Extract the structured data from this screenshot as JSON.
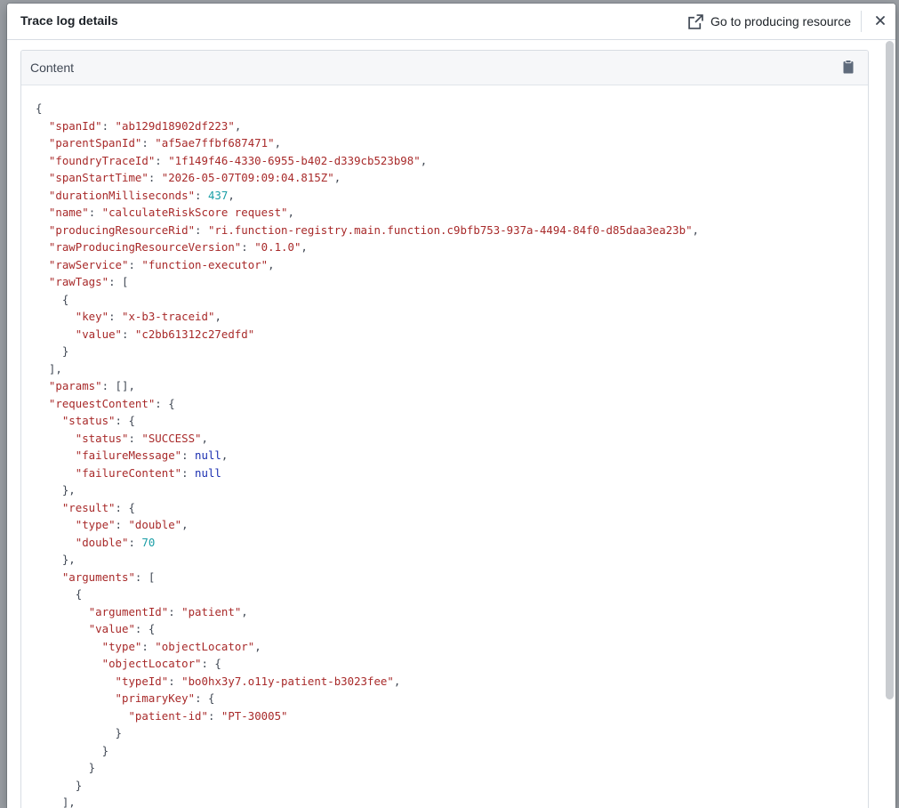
{
  "dialog": {
    "title": "Trace log details",
    "goto_label": "Go to producing resource",
    "content_label": "Content"
  },
  "icons": {
    "goto": "external-link-icon",
    "close": "close-icon",
    "copy": "clipboard-icon"
  },
  "json_lines": [
    [
      [
        "p",
        "{"
      ]
    ],
    [
      [
        "p",
        "  "
      ],
      [
        "k",
        "\"spanId\""
      ],
      [
        "p",
        ": "
      ],
      [
        "s",
        "\"ab129d18902df223\""
      ],
      [
        "p",
        ","
      ]
    ],
    [
      [
        "p",
        "  "
      ],
      [
        "k",
        "\"parentSpanId\""
      ],
      [
        "p",
        ": "
      ],
      [
        "s",
        "\"af5ae7ffbf687471\""
      ],
      [
        "p",
        ","
      ]
    ],
    [
      [
        "p",
        "  "
      ],
      [
        "k",
        "\"foundryTraceId\""
      ],
      [
        "p",
        ": "
      ],
      [
        "s",
        "\"1f149f46-4330-6955-b402-d339cb523b98\""
      ],
      [
        "p",
        ","
      ]
    ],
    [
      [
        "p",
        "  "
      ],
      [
        "k",
        "\"spanStartTime\""
      ],
      [
        "p",
        ": "
      ],
      [
        "s",
        "\"2026-05-07T09:09:04.815Z\""
      ],
      [
        "p",
        ","
      ]
    ],
    [
      [
        "p",
        "  "
      ],
      [
        "k",
        "\"durationMilliseconds\""
      ],
      [
        "p",
        ": "
      ],
      [
        "n",
        "437"
      ],
      [
        "p",
        ","
      ]
    ],
    [
      [
        "p",
        "  "
      ],
      [
        "k",
        "\"name\""
      ],
      [
        "p",
        ": "
      ],
      [
        "s",
        "\"calculateRiskScore request\""
      ],
      [
        "p",
        ","
      ]
    ],
    [
      [
        "p",
        "  "
      ],
      [
        "k",
        "\"producingResourceRid\""
      ],
      [
        "p",
        ": "
      ],
      [
        "s",
        "\"ri.function-registry.main.function.c9bfb753-937a-4494-84f0-d85daa3ea23b\""
      ],
      [
        "p",
        ","
      ]
    ],
    [
      [
        "p",
        "  "
      ],
      [
        "k",
        "\"rawProducingResourceVersion\""
      ],
      [
        "p",
        ": "
      ],
      [
        "s",
        "\"0.1.0\""
      ],
      [
        "p",
        ","
      ]
    ],
    [
      [
        "p",
        "  "
      ],
      [
        "k",
        "\"rawService\""
      ],
      [
        "p",
        ": "
      ],
      [
        "s",
        "\"function-executor\""
      ],
      [
        "p",
        ","
      ]
    ],
    [
      [
        "p",
        "  "
      ],
      [
        "k",
        "\"rawTags\""
      ],
      [
        "p",
        ": ["
      ]
    ],
    [
      [
        "p",
        "    {"
      ]
    ],
    [
      [
        "p",
        "      "
      ],
      [
        "k",
        "\"key\""
      ],
      [
        "p",
        ": "
      ],
      [
        "s",
        "\"x-b3-traceid\""
      ],
      [
        "p",
        ","
      ]
    ],
    [
      [
        "p",
        "      "
      ],
      [
        "k",
        "\"value\""
      ],
      [
        "p",
        ": "
      ],
      [
        "s",
        "\"c2bb61312c27edfd\""
      ]
    ],
    [
      [
        "p",
        "    }"
      ]
    ],
    [
      [
        "p",
        "  ],"
      ]
    ],
    [
      [
        "p",
        "  "
      ],
      [
        "k",
        "\"params\""
      ],
      [
        "p",
        ": [],"
      ]
    ],
    [
      [
        "p",
        "  "
      ],
      [
        "k",
        "\"requestContent\""
      ],
      [
        "p",
        ": {"
      ]
    ],
    [
      [
        "p",
        "    "
      ],
      [
        "k",
        "\"status\""
      ],
      [
        "p",
        ": {"
      ]
    ],
    [
      [
        "p",
        "      "
      ],
      [
        "k",
        "\"status\""
      ],
      [
        "p",
        ": "
      ],
      [
        "s",
        "\"SUCCESS\""
      ],
      [
        "p",
        ","
      ]
    ],
    [
      [
        "p",
        "      "
      ],
      [
        "k",
        "\"failureMessage\""
      ],
      [
        "p",
        ": "
      ],
      [
        "nl",
        "null"
      ],
      [
        "p",
        ","
      ]
    ],
    [
      [
        "p",
        "      "
      ],
      [
        "k",
        "\"failureContent\""
      ],
      [
        "p",
        ": "
      ],
      [
        "nl",
        "null"
      ]
    ],
    [
      [
        "p",
        "    },"
      ]
    ],
    [
      [
        "p",
        "    "
      ],
      [
        "k",
        "\"result\""
      ],
      [
        "p",
        ": {"
      ]
    ],
    [
      [
        "p",
        "      "
      ],
      [
        "k",
        "\"type\""
      ],
      [
        "p",
        ": "
      ],
      [
        "s",
        "\"double\""
      ],
      [
        "p",
        ","
      ]
    ],
    [
      [
        "p",
        "      "
      ],
      [
        "k",
        "\"double\""
      ],
      [
        "p",
        ": "
      ],
      [
        "n",
        "70"
      ]
    ],
    [
      [
        "p",
        "    },"
      ]
    ],
    [
      [
        "p",
        "    "
      ],
      [
        "k",
        "\"arguments\""
      ],
      [
        "p",
        ": ["
      ]
    ],
    [
      [
        "p",
        "      {"
      ]
    ],
    [
      [
        "p",
        "        "
      ],
      [
        "k",
        "\"argumentId\""
      ],
      [
        "p",
        ": "
      ],
      [
        "s",
        "\"patient\""
      ],
      [
        "p",
        ","
      ]
    ],
    [
      [
        "p",
        "        "
      ],
      [
        "k",
        "\"value\""
      ],
      [
        "p",
        ": {"
      ]
    ],
    [
      [
        "p",
        "          "
      ],
      [
        "k",
        "\"type\""
      ],
      [
        "p",
        ": "
      ],
      [
        "s",
        "\"objectLocator\""
      ],
      [
        "p",
        ","
      ]
    ],
    [
      [
        "p",
        "          "
      ],
      [
        "k",
        "\"objectLocator\""
      ],
      [
        "p",
        ": {"
      ]
    ],
    [
      [
        "p",
        "            "
      ],
      [
        "k",
        "\"typeId\""
      ],
      [
        "p",
        ": "
      ],
      [
        "s",
        "\"bo0hx3y7.o11y-patient-b3023fee\""
      ],
      [
        "p",
        ","
      ]
    ],
    [
      [
        "p",
        "            "
      ],
      [
        "k",
        "\"primaryKey\""
      ],
      [
        "p",
        ": {"
      ]
    ],
    [
      [
        "p",
        "              "
      ],
      [
        "k",
        "\"patient-id\""
      ],
      [
        "p",
        ": "
      ],
      [
        "s",
        "\"PT-30005\""
      ]
    ],
    [
      [
        "p",
        "            }"
      ]
    ],
    [
      [
        "p",
        "          }"
      ]
    ],
    [
      [
        "p",
        "        }"
      ]
    ],
    [
      [
        "p",
        "      }"
      ]
    ],
    [
      [
        "p",
        "    ],"
      ]
    ]
  ]
}
